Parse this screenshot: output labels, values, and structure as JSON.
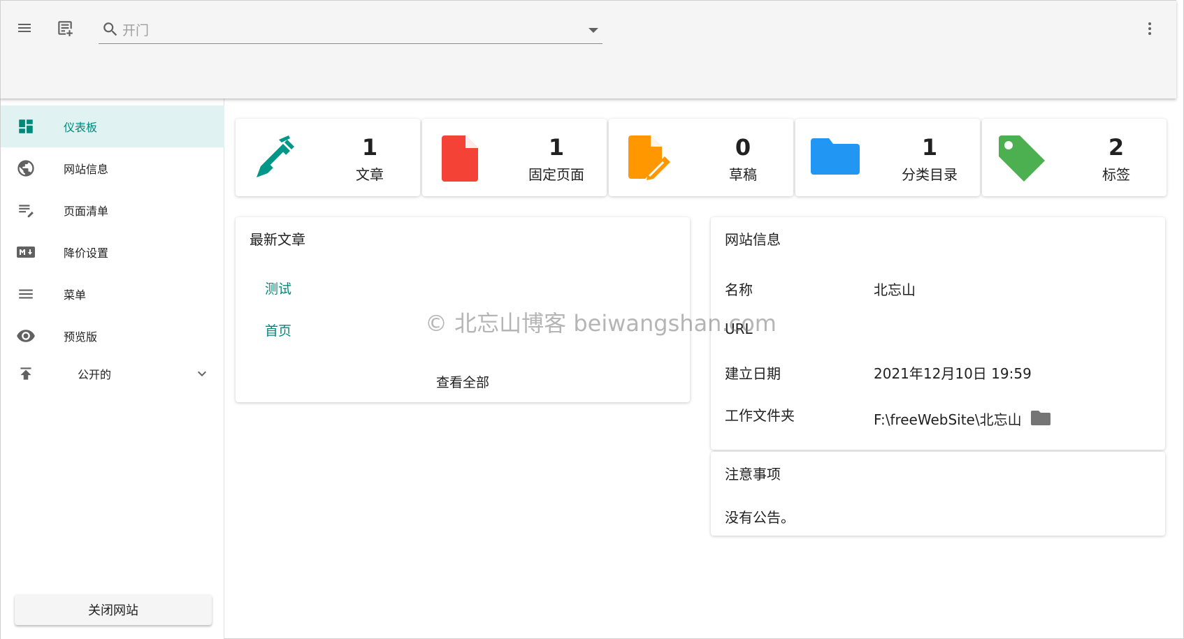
{
  "header": {
    "search_placeholder": "开门"
  },
  "sidebar": {
    "items": [
      {
        "label": "仪表板"
      },
      {
        "label": "网站信息"
      },
      {
        "label": "页面清单"
      },
      {
        "label": "降价设置"
      },
      {
        "label": "菜单"
      },
      {
        "label": "预览版"
      },
      {
        "label": "公开的"
      }
    ],
    "close_label": "关闭网站"
  },
  "stats": [
    {
      "count": "1",
      "label": "文章",
      "color": "#009688"
    },
    {
      "count": "1",
      "label": "固定页面",
      "color": "#f44336"
    },
    {
      "count": "0",
      "label": "草稿",
      "color": "#ff9800"
    },
    {
      "count": "1",
      "label": "分类目录",
      "color": "#2196f3"
    },
    {
      "count": "2",
      "label": "标签",
      "color": "#4caf50"
    }
  ],
  "recent_posts": {
    "title": "最新文章",
    "items": [
      "测试",
      "首页"
    ],
    "view_all": "查看全部"
  },
  "site_info": {
    "title": "网站信息",
    "rows": [
      {
        "label": "名称",
        "value": "北忘山"
      },
      {
        "label": "URL",
        "value": ""
      },
      {
        "label": "建立日期",
        "value": "2021年12月10日 19:59"
      },
      {
        "label": "工作文件夹",
        "value": "F:\\freeWebSite\\北忘山"
      }
    ]
  },
  "notice": {
    "title": "注意事项",
    "text": "没有公告。"
  },
  "watermark": "© 北忘山博客 beiwangshan.com",
  "colors": {
    "accent": "#009688",
    "active_bg": "#e0f2f1"
  }
}
